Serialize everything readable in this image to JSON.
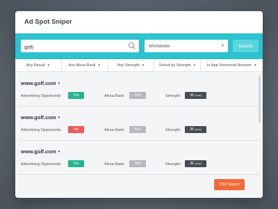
{
  "app": {
    "title": "Ad Spot Sniper"
  },
  "search": {
    "value": "golf|",
    "button_label": "Search"
  },
  "location_select": {
    "value": "Worldwide"
  },
  "filters": [
    "Any Result",
    "Any Alexa Rank",
    "Any Strenght",
    "Sorted by Strenght",
    "In-App Horizontal Browser"
  ],
  "labels": {
    "advertising_opportunity": "Advertising Opportunity:",
    "alexa_rank": "Alexa Rank:",
    "strenght": "Strenght:"
  },
  "results": [
    {
      "domain": "www.golf.com",
      "opportunity": "Yes",
      "alexa_rank": "N/A",
      "strenght": "36",
      "strenght_level": "(Low)"
    },
    {
      "domain": "www.golf.com",
      "opportunity": "No",
      "alexa_rank": "N/A",
      "strenght": "36",
      "strenght_level": "(Low)"
    },
    {
      "domain": "www.golf.com",
      "opportunity": "Yes",
      "alexa_rank": "N/A",
      "strenght": "36",
      "strenght_level": "(Low)"
    }
  ],
  "footer": {
    "export_label": "CSV Export"
  },
  "colors": {
    "accent": "#2ec1d0",
    "yes": "#26b48f",
    "no": "#ee5a59",
    "neutral": "#b5b8bc",
    "score": "#474c52",
    "export": "#ef6c3a"
  },
  "icons": {
    "search": "search-icon",
    "dropdown": "chevron-down-icon",
    "sort": "sort-icon"
  }
}
